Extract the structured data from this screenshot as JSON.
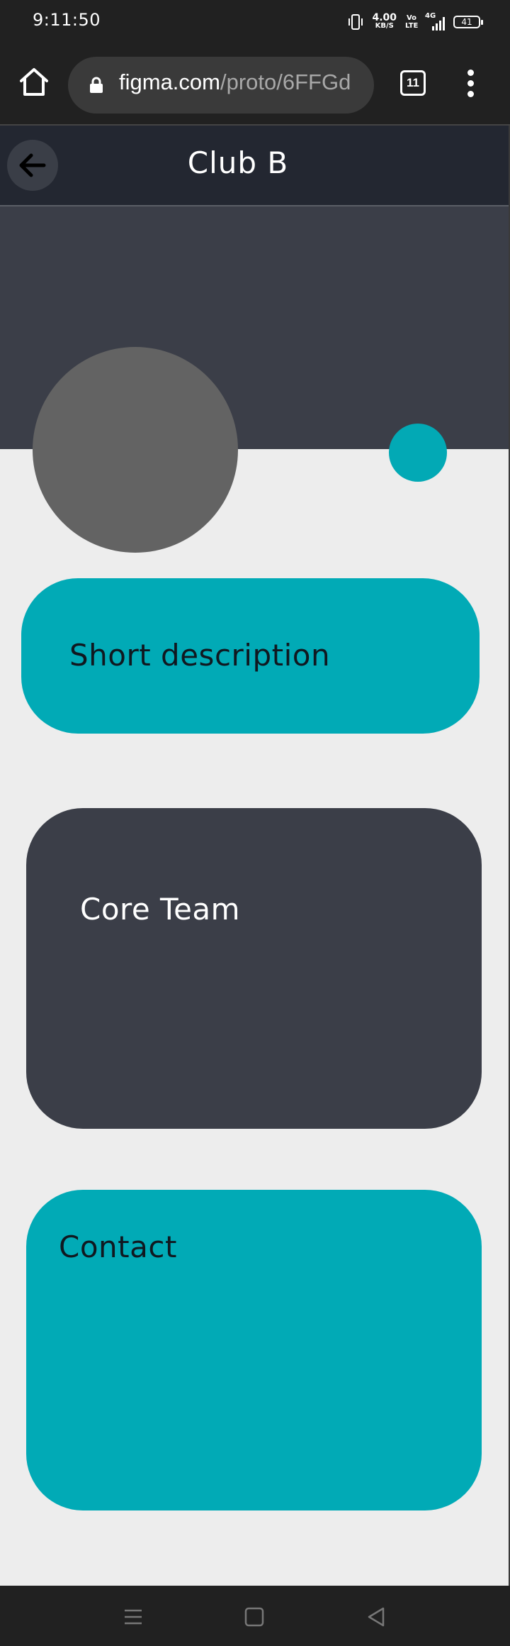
{
  "status_bar": {
    "time": "9:11:50",
    "net_speed": "4.00",
    "net_unit": "KB/S",
    "volte": "Vo LTE",
    "signal": "4G",
    "battery": "41"
  },
  "browser": {
    "url_domain": "figma.com",
    "url_path": "/proto/6FFGd",
    "tab_count": "11"
  },
  "app": {
    "title": "Club B"
  },
  "cards": {
    "description_label": "Short description",
    "team_label": "Core Team",
    "contact_label": "Contact"
  },
  "colors": {
    "accent": "#01aab6",
    "dark_panel": "#3b3e48",
    "header_bg": "#232731",
    "page_bg": "#ededed",
    "avatar_placeholder": "#636363"
  },
  "icons": {
    "home": "home-icon",
    "lock": "lock-icon",
    "tabs": "tabs-icon",
    "menu": "more-vert-icon",
    "back": "arrow-left-icon",
    "nav_recents": "menu-lines-icon",
    "nav_home": "square-icon",
    "nav_back": "triangle-back-icon"
  }
}
